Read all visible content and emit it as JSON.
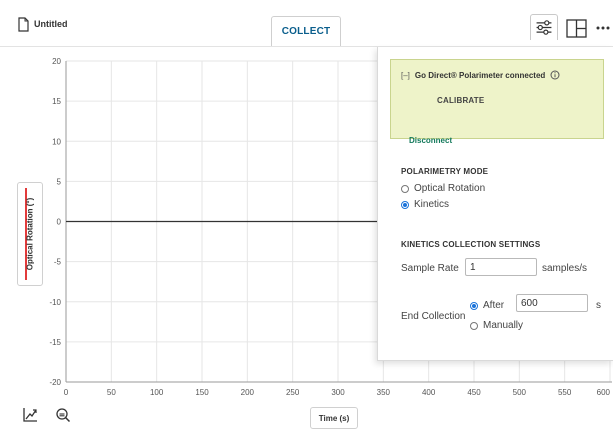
{
  "toolbar": {
    "file_title": "Untitled",
    "collect_label": "COLLECT",
    "icons": [
      "file-icon",
      "sensor-settings-icon",
      "layout-icon",
      "more-options-icon"
    ]
  },
  "graph": {
    "y_axis_label": "Optical Rotation (°)",
    "x_axis_label": "Time (s)",
    "y_ticks": [
      "20",
      "15",
      "10",
      "5",
      "0",
      "-5",
      "-10",
      "-15",
      "-20"
    ],
    "x_ticks": [
      "0",
      "50",
      "100",
      "150",
      "200",
      "250",
      "300",
      "350",
      "400",
      "450",
      "500",
      "550",
      "600"
    ],
    "series_color": "#e23b3b",
    "bottom_icons": [
      "graph-options-icon",
      "zoom-icon"
    ]
  },
  "panel": {
    "device": {
      "collapse_symbol": "[–]",
      "name": "Go Direct® Polarimeter connected",
      "calibrate_label": "CALIBRATE",
      "disconnect_label": "Disconnect"
    },
    "mode": {
      "title": "POLARIMETRY MODE",
      "options": [
        {
          "label": "Optical Rotation",
          "selected": false
        },
        {
          "label": "Kinetics",
          "selected": true
        }
      ]
    },
    "kinetics": {
      "title": "KINETICS COLLECTION SETTINGS",
      "sample_rate_label": "Sample Rate",
      "sample_rate_value": "1",
      "sample_rate_unit": "samples/s",
      "end_collection_label": "End Collection",
      "after_label": "After",
      "after_value": "600",
      "after_unit": "s",
      "manually_label": "Manually",
      "end_mode_after_selected": true
    },
    "accent_color": "#eef3c9"
  }
}
